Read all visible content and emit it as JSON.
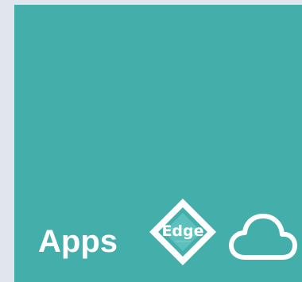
{
  "tile": {
    "label": "Apps",
    "background_color": "#44aeaa",
    "badge": {
      "icon": "edge-diamond-icon",
      "text": "Edge"
    },
    "cloud": {
      "icon": "cloud-icon"
    }
  }
}
